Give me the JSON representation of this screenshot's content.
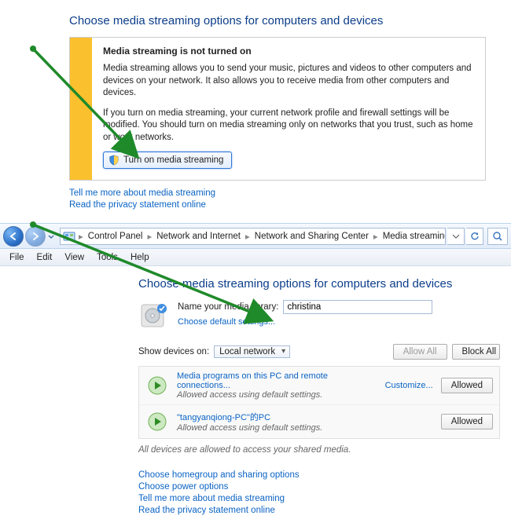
{
  "top": {
    "heading": "Choose media streaming options for computers and devices",
    "box_title": "Media streaming is not turned on",
    "para1": "Media streaming allows you to send your music, pictures and videos to other computers and devices on your network.  It also allows you to receive media from other computers and devices.",
    "para2": "If you turn on media streaming, your current network profile and firewall settings will be modified. You should turn on media streaming only on networks that you trust, such as home or work networks.",
    "button_label": "Turn on media streaming",
    "link_more": "Tell me more about media streaming",
    "link_privacy": "Read the privacy statement online"
  },
  "breadcrumbs": {
    "items": [
      "Control Panel",
      "Network and Internet",
      "Network and Sharing Center",
      "Media streaming options"
    ]
  },
  "menus": {
    "file": "File",
    "edit": "Edit",
    "view": "View",
    "tools": "Tools",
    "help": "Help"
  },
  "main": {
    "heading": "Choose media streaming options for computers and devices",
    "name_label": "Name your media library:",
    "name_value": "christina",
    "default_link": "Choose default settings...",
    "show_devices_label": "Show devices on:",
    "show_devices_value": "Local network",
    "allow_all": "Allow All",
    "block_all": "Block All",
    "devices": [
      {
        "title": "Media programs on this PC and remote connections...",
        "subtitle": "Allowed access using default settings.",
        "customize": "Customize...",
        "status": "Allowed"
      },
      {
        "title": "\"tangyanqiong-PC\"的PC",
        "subtitle": "Allowed access using default settings.",
        "customize": "",
        "status": "Allowed"
      }
    ],
    "footer_note": "All devices are allowed to access your shared media.",
    "links": {
      "homegroup": "Choose homegroup and sharing options",
      "power": "Choose power options",
      "more": "Tell me more about media streaming",
      "privacy": "Read the privacy statement online"
    }
  }
}
